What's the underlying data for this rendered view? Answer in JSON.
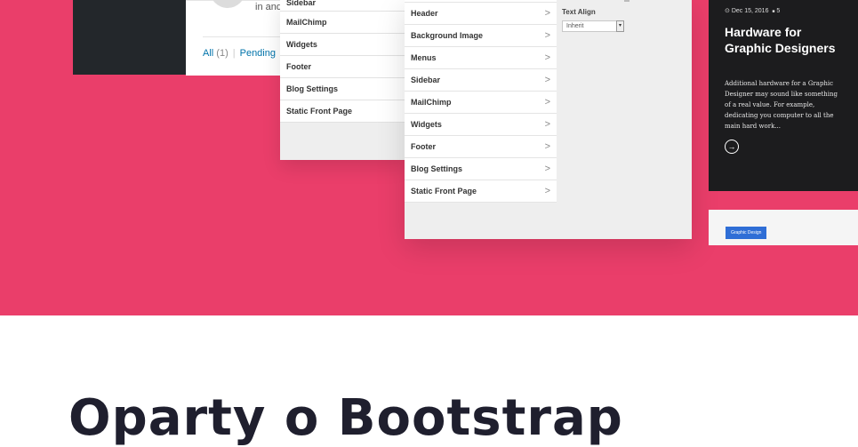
{
  "wp": {
    "partial_text": "in and",
    "footer": {
      "all": "All",
      "all_count": "(1)",
      "separator": "|",
      "pending": "Pending"
    }
  },
  "menu_left": {
    "partial_item": "Sidebar",
    "items": [
      "MailChimp",
      "Widgets",
      "Footer",
      "Blog Settings",
      "Static Front Page"
    ]
  },
  "customizer": {
    "items": [
      "Header",
      "Background Image",
      "Menus",
      "Sidebar",
      "MailChimp",
      "Widgets",
      "Footer",
      "Blog Settings",
      "Static Front Page"
    ],
    "chevron": ">",
    "text_align_label": "Text Align",
    "text_align_value": "Inherit"
  },
  "blog_card": {
    "date_icon": "⊙",
    "date": "Dec 15, 2016",
    "comment_icon": "■",
    "comments": "5",
    "title": "Hardware for Graphic Designers",
    "excerpt": "Additional hardware for a Graphic Designer may sound like something of a real value. For example, dedicating you computer to all the main hard work...",
    "button_icon": "→"
  },
  "card2": {
    "tag": "Graphic Design"
  },
  "heading": "Oparty o Bootstrap",
  "colors": {
    "hero": "#ea3e6a",
    "dark": "#1c1c1e",
    "heading": "#1f1f2e"
  }
}
